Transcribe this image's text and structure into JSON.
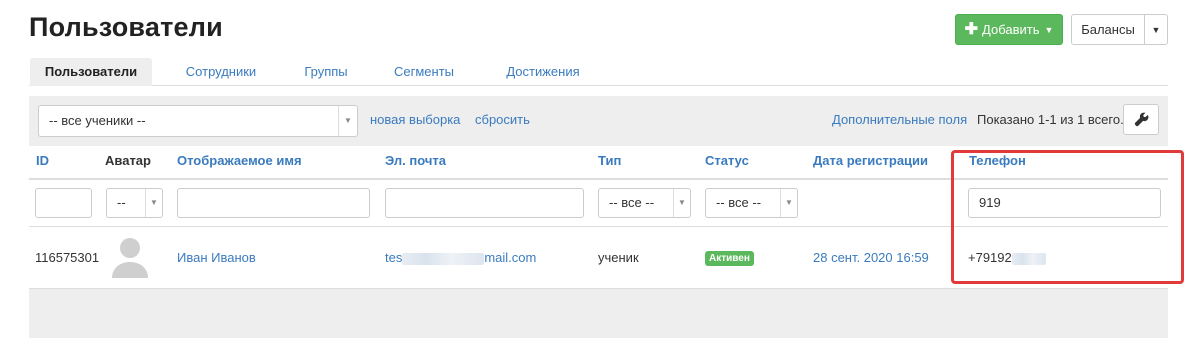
{
  "header": {
    "title": "Пользователи",
    "add_button": "Добавить",
    "balances_button": "Балансы"
  },
  "tabs": [
    {
      "label": "Пользователи",
      "active": true
    },
    {
      "label": "Сотрудники",
      "active": false
    },
    {
      "label": "Группы",
      "active": false
    },
    {
      "label": "Сегменты",
      "active": false
    },
    {
      "label": "Достижения",
      "active": false
    }
  ],
  "toolbar": {
    "segment_select": "-- все ученики --",
    "new_selection": "новая выборка",
    "reset": "сбросить",
    "extra_fields": "Дополнительные поля",
    "shown": "Показано 1-1 из 1 всего."
  },
  "table": {
    "columns": [
      "ID",
      "Аватар",
      "Отображаемое имя",
      "Эл. почта",
      "Тип",
      "Статус",
      "Дата регистрации",
      "Телефон"
    ],
    "filters": {
      "id": "",
      "avatar": "--",
      "name": "",
      "email": "",
      "type": "-- все --",
      "status": "-- все --",
      "phone": "919"
    },
    "rows": [
      {
        "id": "116575301",
        "name": "Иван Иванов",
        "email_start": "tes",
        "email_end": "mail.com",
        "type": "ученик",
        "status": "Активен",
        "registered": "28 сент. 2020 16:59",
        "phone_start": "+79192"
      }
    ]
  },
  "colors": {
    "primary_button": "#5cb85c",
    "link": "#3a7bbf",
    "highlight": "#e03a3a"
  },
  "icons": [
    "plus-icon",
    "caret-down-icon",
    "wrench-icon",
    "avatar-placeholder-icon"
  ]
}
